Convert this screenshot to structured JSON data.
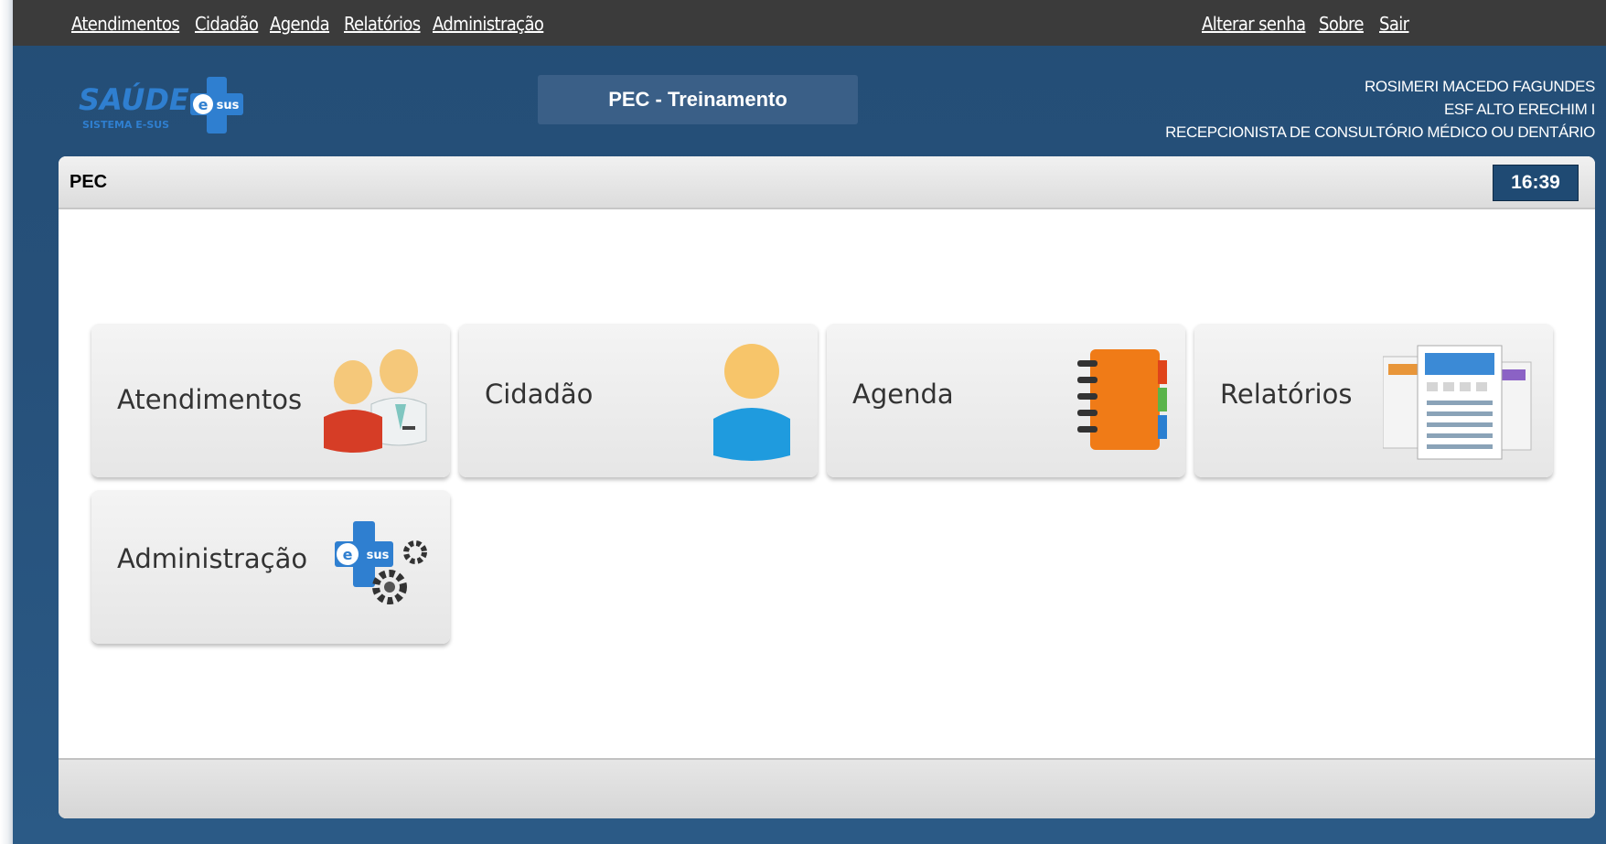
{
  "topnav": {
    "left_links": [
      "Atendimentos",
      "Cidadão",
      "Agenda",
      "Relatórios",
      "Administração"
    ],
    "right_links": [
      "Alterar senha",
      "Sobre",
      "Sair"
    ]
  },
  "logo": {
    "main": "SAÚDE",
    "sub": "SISTEMA E-SUS",
    "badge": "sus"
  },
  "environment": {
    "label": "PEC - Treinamento"
  },
  "user": {
    "name": "ROSIMERI MACEDO FAGUNDES",
    "team": "ESF ALTO ERECHIM I",
    "role": "RECEPCIONISTA DE CONSULTÓRIO MÉDICO OU DENTÁRIO"
  },
  "panel": {
    "title": "PEC",
    "clock": "16:39"
  },
  "tiles": [
    {
      "label": "Atendimentos",
      "icon": "people-icon"
    },
    {
      "label": "Cidadão",
      "icon": "person-icon"
    },
    {
      "label": "Agenda",
      "icon": "notebook-icon"
    },
    {
      "label": "Relatórios",
      "icon": "reports-icon"
    },
    {
      "label": "Administração",
      "icon": "esus-gears-icon"
    }
  ],
  "colors": {
    "header_bg": "#26507a",
    "topbar_bg": "#3b3b3b",
    "clock_bg": "#1f4a73"
  }
}
